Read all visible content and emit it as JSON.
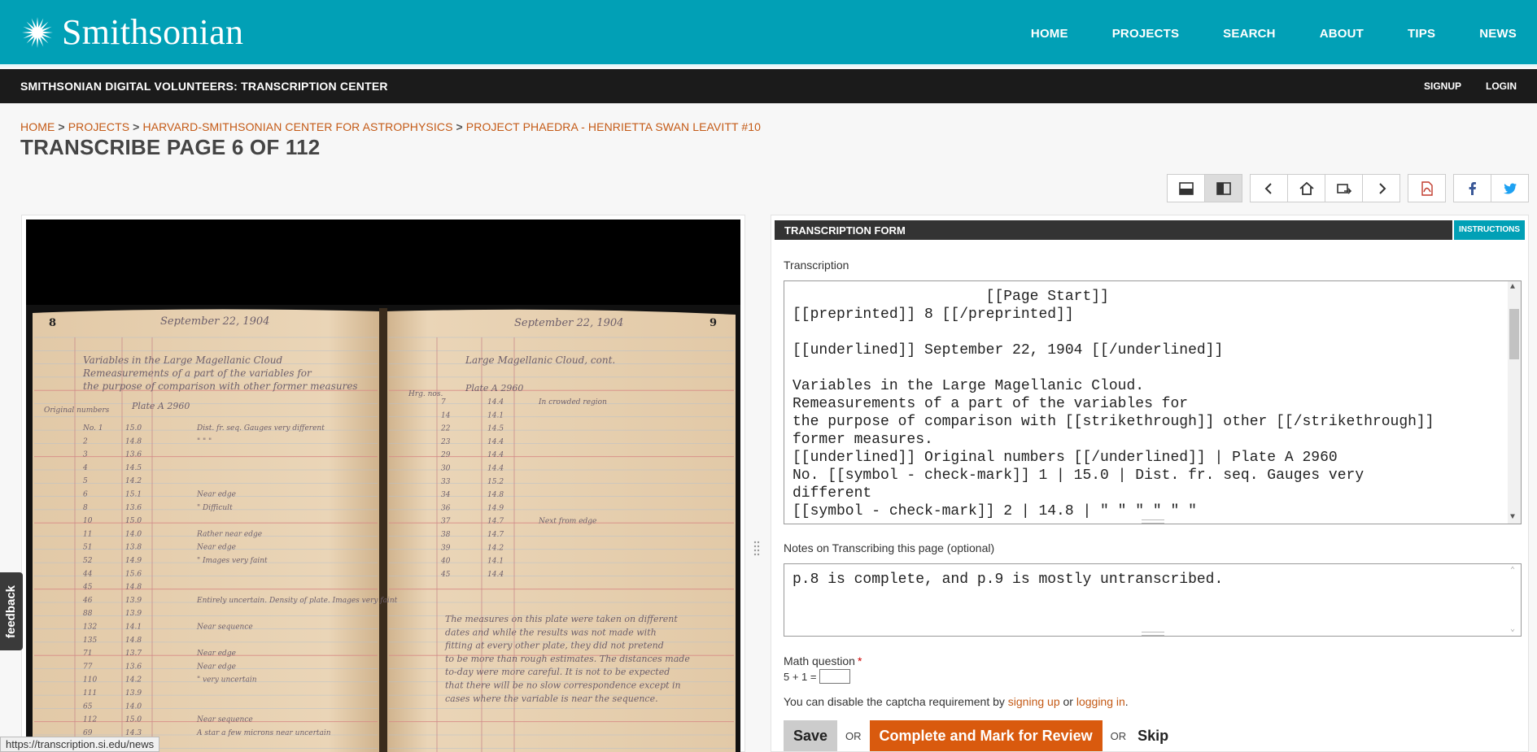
{
  "brand": {
    "name": "Smithsonian",
    "logo_icon": "sunburst-icon"
  },
  "main_nav": [
    "HOME",
    "PROJECTS",
    "SEARCH",
    "ABOUT",
    "TIPS",
    "NEWS"
  ],
  "subbar": {
    "title": "SMITHSONIAN DIGITAL VOLUNTEERS: TRANSCRIPTION CENTER",
    "signup": "SIGNUP",
    "login": "LOGIN"
  },
  "breadcrumb": [
    "Home",
    "Projects",
    "Harvard-Smithsonian Center for Astrophysics",
    "Project PHaEDRA - Henrietta Swan Leavitt #10"
  ],
  "breadcrumb_sep": ">",
  "page_title": "TRANSCRIBE PAGE 6 OF 112",
  "toolbar_icons": [
    "layout-stacked-icon",
    "layout-side-by-side-icon",
    "prev-icon",
    "home-icon",
    "rotate-icon",
    "next-icon",
    "pdf-icon",
    "facebook-icon",
    "twitter-icon"
  ],
  "form": {
    "header": "TRANSCRIPTION FORM",
    "instructions": "INSTRUCTIONS",
    "transcription_label": "Transcription",
    "transcription_text": "                      [[Page Start]]\n[[preprinted]] 8 [[/preprinted]]\n\n[[underlined]] September 22, 1904 [[/underlined]]\n\nVariables in the Large Magellanic Cloud.\nRemeasurements of a part of the variables for\nthe purpose of comparison with [[strikethrough]] other [[/strikethrough]]\nformer measures.\n[[underlined]] Original numbers [[/underlined]] | Plate A 2960\nNo. [[symbol - check-mark]] 1 | 15.0 | Dist. fr. seq. Gauges very\ndifferent\n[[symbol - check-mark]] 2 | 14.8 | \" \" \" \" \" \"",
    "notes_label": "Notes on Transcribing this page (optional)",
    "notes_text": "p.8 is complete, and p.9 is mostly untranscribed.",
    "math_label": "Math question",
    "math_required": "*",
    "math_question": "5 + 1 =",
    "captcha_pre": "You can disable the captcha requirement by",
    "captcha_signup": "signing up",
    "captcha_or": "or",
    "captcha_login": "logging in",
    "captcha_post": ".",
    "save": "Save",
    "or": "OR",
    "complete": "Complete and Mark for Review",
    "skip": "Skip"
  },
  "notebook": {
    "left_page_number": "8",
    "right_page_number": "9",
    "left_date": "September 22, 1904",
    "right_date": "September 22, 1904",
    "left_heading_1": "Variables in the Large Magellanic Cloud",
    "left_heading_2": "Remeasurements of a part of the variables for",
    "left_heading_3": "the purpose of comparison with other former measures",
    "right_heading": "Large Magellanic Cloud, cont.",
    "left_col_1": "Original numbers",
    "left_col_2": "Plate A 2960",
    "right_col_1": "Hrg. nos.",
    "right_col_2": "Plate A 2960",
    "left_rows": [
      [
        "No. 1",
        "15.0",
        "Dist. fr. seq. Gauges very different"
      ],
      [
        "2",
        "14.8",
        "\" \" \""
      ],
      [
        "3",
        "13.6",
        ""
      ],
      [
        "4",
        "14.5",
        ""
      ],
      [
        "5",
        "14.2",
        ""
      ],
      [
        "6",
        "15.1",
        "Near edge"
      ],
      [
        "8",
        "13.6",
        "\" Difficult"
      ],
      [
        "10",
        "15.0",
        ""
      ],
      [
        "11",
        "14.0",
        "Rather near edge"
      ],
      [
        "51",
        "13.8",
        "Near edge"
      ],
      [
        "52",
        "14.9",
        "\" Images very faint"
      ],
      [
        "44",
        "15.6",
        ""
      ],
      [
        "45",
        "14.8",
        ""
      ],
      [
        "46",
        "13.9",
        "Entirely uncertain. Density of plate. Images very faint"
      ],
      [
        "88",
        "13.9",
        ""
      ],
      [
        "132",
        "14.1",
        "Near sequence"
      ],
      [
        "135",
        "14.8",
        ""
      ],
      [
        "71",
        "13.7",
        "Near edge"
      ],
      [
        "77",
        "13.6",
        "Near edge"
      ],
      [
        "110",
        "14.2",
        "\" very uncertain"
      ],
      [
        "111",
        "13.9",
        ""
      ],
      [
        "65",
        "14.0",
        ""
      ],
      [
        "112",
        "15.0",
        "Near sequence"
      ],
      [
        "69",
        "14.3",
        "A star a few microns near uncertain"
      ]
    ],
    "right_rows": [
      [
        "7",
        "14.4",
        "In crowded region"
      ],
      [
        "14",
        "14.1",
        ""
      ],
      [
        "22",
        "14.5",
        ""
      ],
      [
        "23",
        "14.4",
        ""
      ],
      [
        "29",
        "14.4",
        ""
      ],
      [
        "30",
        "14.4",
        ""
      ],
      [
        "33",
        "15.2",
        ""
      ],
      [
        "34",
        "14.8",
        ""
      ],
      [
        "36",
        "14.9",
        ""
      ],
      [
        "37",
        "14.7",
        "Next from edge"
      ],
      [
        "38",
        "14.7",
        ""
      ],
      [
        "39",
        "14.2",
        ""
      ],
      [
        "40",
        "14.1",
        ""
      ],
      [
        "45",
        "14.4",
        ""
      ]
    ],
    "right_paragraph": "The measures on this plate were taken on different dates and while the results was not made with fitting at every other plate, they did not pretend to be more than rough estimates. The distances made to-day were more careful. It is not to be expected that there will be no slow correspondence except in cases where the variable is near the sequence."
  },
  "feedback": "feedback",
  "status_url": "https://transcription.si.edu/news"
}
